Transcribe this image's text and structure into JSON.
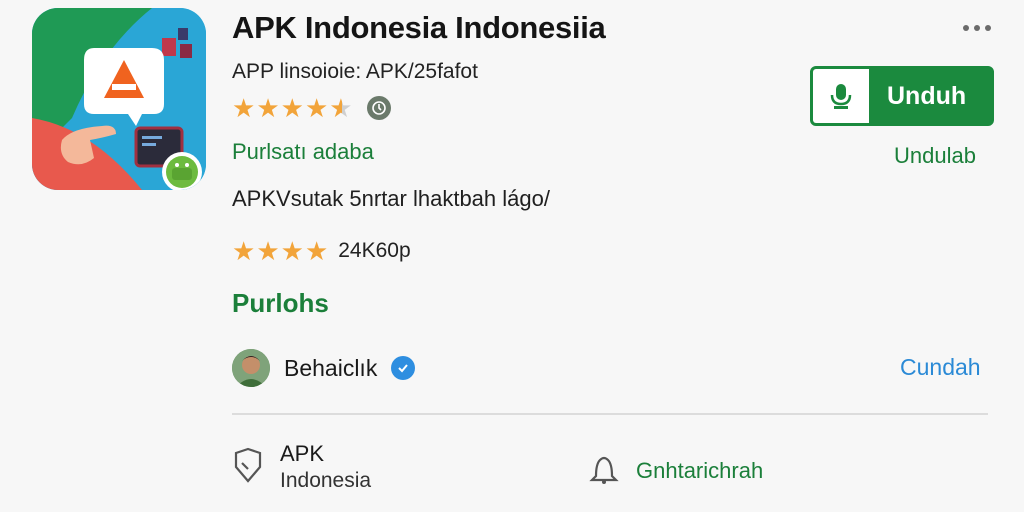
{
  "app": {
    "title": "APK Indonesia Indonesiia",
    "subtitle": "APP linsoioie: APK/25fafot",
    "rating_stars": 4.5,
    "developer": "Purlsatı adaba",
    "description": "APKVsutak 5nrtar lhaktbah lágo/",
    "review_stars": 4,
    "review_count": "24K60p",
    "section_title": "Purlohs"
  },
  "author": {
    "name": "Behaiclık",
    "action": "Cundah"
  },
  "actions": {
    "install_label": "Unduh",
    "secondary_label": "Undulab"
  },
  "bottom": {
    "left_line1": "APK",
    "left_line2": "Indonesia",
    "right_label": "Gnhtarichrah"
  },
  "colors": {
    "accent_green": "#1b8a3e",
    "link_blue": "#2b8ad6",
    "star": "#f2a43a"
  },
  "icons": [
    "app-icon",
    "more-icon",
    "clock-icon",
    "microphone-icon",
    "verified-icon",
    "tag-icon",
    "bell-icon"
  ]
}
